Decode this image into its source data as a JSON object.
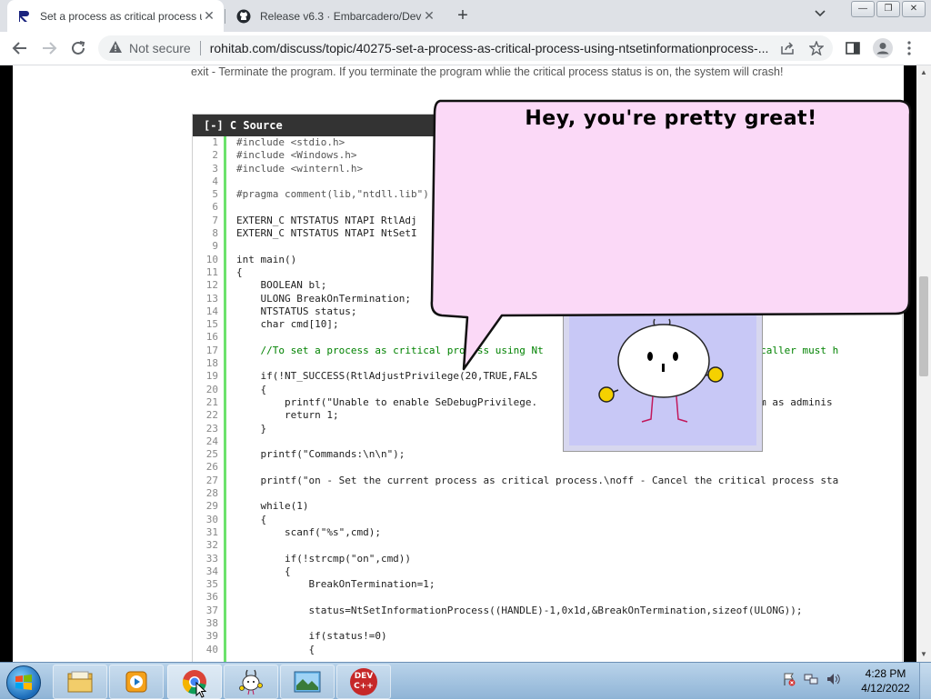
{
  "browser": {
    "tabs": [
      {
        "title": "Set a process as critical process u",
        "favicon": "rohitab-icon",
        "active": true
      },
      {
        "title": "Release v6.3 · Embarcadero/Dev-",
        "favicon": "github-icon",
        "active": false
      }
    ],
    "close_glyph": "✕",
    "new_tab_glyph": "+",
    "tab_search_glyph": "⌄",
    "security_label": "Not secure",
    "url": "rohitab.com/discuss/topic/40275-set-a-process-as-critical-process-using-ntsetinformationprocess-..."
  },
  "page": {
    "intro_text": "exit - Terminate the program. If you terminate the program whlie the critical process status is on, the system will crash!",
    "code_header": "[-] C Source",
    "line_numbers": [
      "1",
      "2",
      "3",
      "4",
      "5",
      "6",
      "7",
      "8",
      "9",
      "10",
      "11",
      "12",
      "13",
      "14",
      "15",
      "16",
      "17",
      "18",
      "19",
      "20",
      "21",
      "22",
      "23",
      "24",
      "25",
      "26",
      "27",
      "28",
      "29",
      "30",
      "31",
      "32",
      "33",
      "34",
      "35",
      "36",
      "37",
      "38",
      "39",
      "40"
    ],
    "code_lines": [
      "#include <stdio.h>",
      "#include <Windows.h>",
      "#include <winternl.h>",
      "",
      "#pragma comment(lib,\"ntdll.lib\")",
      "",
      "EXTERN_C NTSTATUS NTAPI RtlAdj",
      "EXTERN_C NTSTATUS NTAPI NtSetI",
      "",
      "int main()",
      "{",
      "    BOOLEAN bl;",
      "    ULONG BreakOnTermination;",
      "    NTSTATUS status;",
      "    char cmd[10];",
      "",
      "    //To set a process as critical process using Nt                              , the caller must h",
      "",
      "    if(!NT_SUCCESS(RtlAdjustPrivilege(20,TRUE,FALS",
      "    {",
      "        printf(\"Unable to enable SeDebugPrivilege.                               program as adminis",
      "        return 1;",
      "    }",
      "",
      "    printf(\"Commands:\\n\\n\");",
      "",
      "    printf(\"on - Set the current process as critical process.\\noff - Cancel the critical process sta",
      "",
      "    while(1)",
      "    {",
      "        scanf(\"%s\",cmd);",
      "",
      "        if(!strcmp(\"on\",cmd))",
      "        {",
      "            BreakOnTermination=1;",
      "",
      "            status=NtSetInformationProcess((HANDLE)-1,0x1d,&BreakOnTermination,sizeof(ULONG));",
      "",
      "            if(status!=0)",
      "            {"
    ]
  },
  "overlay": {
    "speech_text": "Hey, you're pretty great!"
  },
  "taskbar": {
    "items": [
      "windows-explorer",
      "media-player",
      "chrome",
      "desktop-buddy",
      "screenshot-app",
      "dev-cpp"
    ],
    "dev_label_1": "DEV",
    "dev_label_2": "C++",
    "time": "4:28 PM",
    "date": "4/12/2022"
  },
  "colors": {
    "code_green": "#008200",
    "code_blue": "#006699",
    "tab_bg": "#dee1e6",
    "bubble_fill": "#fbd9f7"
  }
}
